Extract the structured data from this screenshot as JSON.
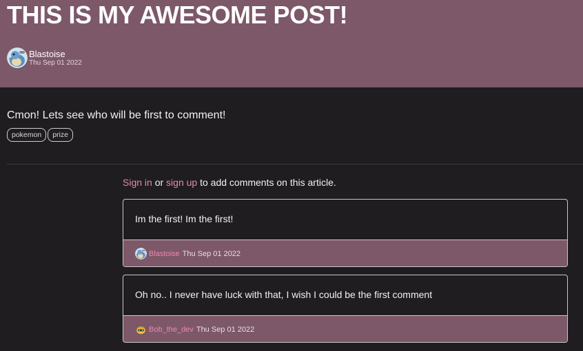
{
  "post": {
    "title": "THIS IS MY AWESOME POST!",
    "author": "Blastoise",
    "date": "Thu Sep 01 2022",
    "body": "Cmon! Lets see who will be first to comment!",
    "tags": [
      "pokemon",
      "prize"
    ]
  },
  "comments_prompt": {
    "sign_in": "Sign in",
    "or": " or ",
    "sign_up": "sign up",
    "rest": " to add comments on this article."
  },
  "comments": [
    {
      "text": "Im the first! Im the first!",
      "author": "Blastoise",
      "date": "Thu Sep 01 2022",
      "avatar_icon": "blastoise-avatar-icon"
    },
    {
      "text": "Oh no.. I never have luck with that, I wish I could be the first comment",
      "author": "Bob_the_dev",
      "date": "Thu Sep 01 2022",
      "avatar_icon": "bob-avatar-icon"
    }
  ],
  "colors": {
    "banner": "#7d5868",
    "background": "#1f1d20",
    "link": "#e889b3"
  }
}
